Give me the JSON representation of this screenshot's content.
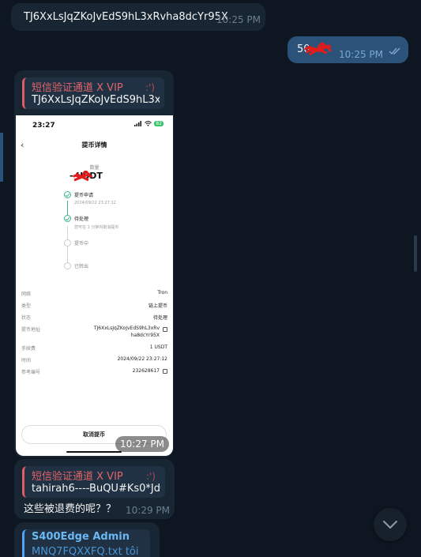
{
  "messages": {
    "m1": {
      "text": "TJ6XxLsJqZKoJvEdS9hL3xRvha8dcYr95X",
      "time": "10:25 PM"
    },
    "m2": {
      "text": "50",
      "time": "10:25 PM",
      "status_icon": "double-check-icon"
    },
    "m3": {
      "reply_name": "短信验证通道 X VIP",
      "reply_text": "TJ6XxLsJqZKoJvEdS9hL3x...",
      "reply_emoji": ":')",
      "image_time": "10:27 PM",
      "screenshot": {
        "status_time": "23:27",
        "battery": "82",
        "title": "提币详情",
        "amount_label": "数量",
        "amount": "-    USDT",
        "steps": [
          {
            "title": "提币申请",
            "sub": "2024/09/22 23:27:12",
            "done": true
          },
          {
            "title": "待处理",
            "sub": "您可在 1 分钟内取消提币",
            "done": true
          },
          {
            "title": "提币中",
            "sub": "",
            "done": false
          },
          {
            "title": "已转出",
            "sub": "",
            "done": false
          }
        ],
        "details": [
          {
            "label": "网络",
            "value": "Tron"
          },
          {
            "label": "类型",
            "value": "链上提币"
          },
          {
            "label": "状态",
            "value": "待处理"
          },
          {
            "label": "提币地址",
            "value": "TJ6XxLsJqZKoJvEdS9hL3xRv",
            "value2": "ha8dcYr95X"
          },
          {
            "label": "手续费",
            "value": "1 USDT"
          },
          {
            "label": "时间",
            "value": "2024/09/22 23:27:12"
          },
          {
            "label": "参考编号",
            "value": "232628617"
          }
        ],
        "cancel_label": "取消提币"
      }
    },
    "m4": {
      "reply_name": "短信验证通道 X VIP",
      "reply_text": "tahirah6----BuQU#Ks0*Jd0...",
      "reply_emoji": ":')",
      "text": "这些被退费的呢？？",
      "time": "10:29 PM"
    },
    "m5": {
      "reply_name": "S400Edge Admin",
      "reply_text": "MNQ7FQXXFQ.txt  tôi"
    }
  },
  "colors": {
    "background": "#0e1621",
    "incoming_bubble": "#182533",
    "outgoing_bubble": "#2b5278",
    "reply_accent_red": "#e15d63",
    "reply_accent_blue": "#4ea4f6",
    "success_green": "#3cb88b"
  }
}
